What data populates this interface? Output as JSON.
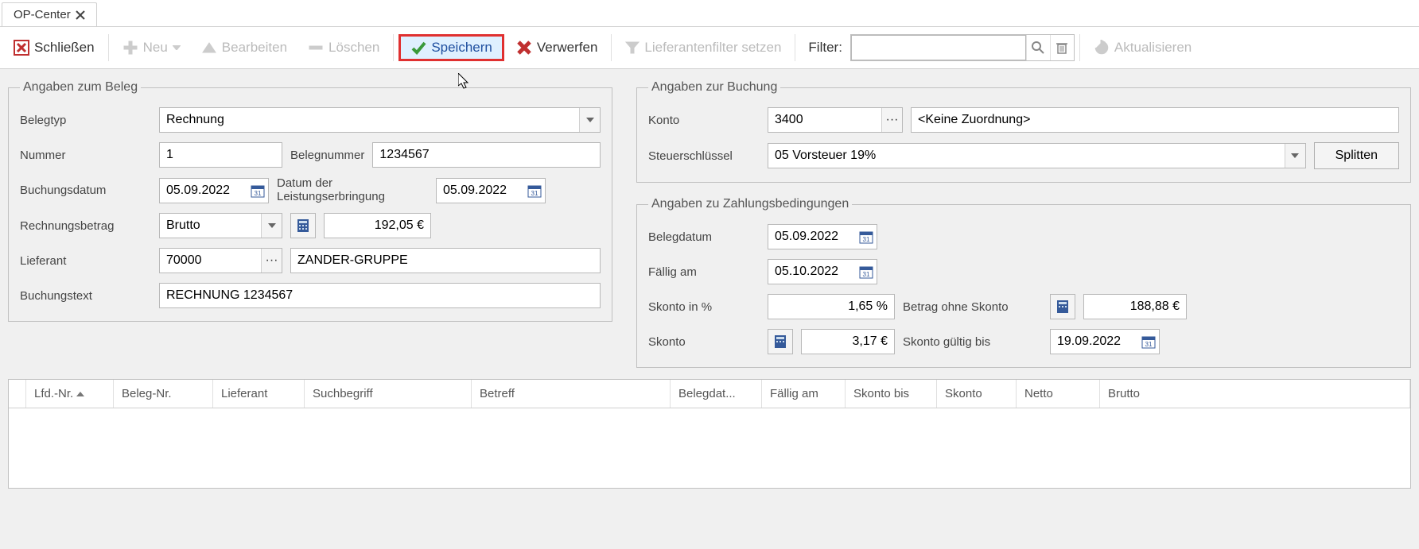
{
  "tab": {
    "title": "OP-Center"
  },
  "toolbar": {
    "close": "Schließen",
    "new": "Neu",
    "edit": "Bearbeiten",
    "delete": "Löschen",
    "save": "Speichern",
    "discard": "Verwerfen",
    "supplier_filter": "Lieferantenfilter setzen",
    "filter_label": "Filter:",
    "refresh": "Aktualisieren"
  },
  "beleg": {
    "legend": "Angaben zum Beleg",
    "belegtyp_label": "Belegtyp",
    "belegtyp_value": "Rechnung",
    "nummer_label": "Nummer",
    "nummer_value": "1",
    "belegnummer_label": "Belegnummer",
    "belegnummer_value": "1234567",
    "buchungsdatum_label": "Buchungsdatum",
    "buchungsdatum_value": "05.09.2022",
    "leistung_label": "Datum der Leistungserbringung",
    "leistung_value": "05.09.2022",
    "rbetrag_label": "Rechnungsbetrag",
    "rbetrag_mode": "Brutto",
    "rbetrag_value": "192,05 €",
    "lieferant_label": "Lieferant",
    "lieferant_code": "70000",
    "lieferant_name": "ZANDER-GRUPPE",
    "buchungstext_label": "Buchungstext",
    "buchungstext_value": "RECHNUNG 1234567"
  },
  "buchung": {
    "legend": "Angaben zur Buchung",
    "konto_label": "Konto",
    "konto_value": "3400",
    "konto_assign": "<Keine Zuordnung>",
    "steuer_label": "Steuerschlüssel",
    "steuer_value": "05 Vorsteuer 19%",
    "splitten": "Splitten"
  },
  "zahlung": {
    "legend": "Angaben zu Zahlungsbedingungen",
    "belegdatum_label": "Belegdatum",
    "belegdatum_value": "05.09.2022",
    "faellig_label": "Fällig am",
    "faellig_value": "05.10.2022",
    "skonto_pct_label": "Skonto in %",
    "skonto_pct_value": "1,65 %",
    "betrag_ohne_label": "Betrag ohne Skonto",
    "betrag_ohne_value": "188,88 €",
    "skonto_label": "Skonto",
    "skonto_value": "3,17 €",
    "skonto_bis_label": "Skonto gültig bis",
    "skonto_bis_value": "19.09.2022"
  },
  "table": {
    "cols": {
      "c0": "Lfd.-Nr.",
      "c1": "Beleg-Nr.",
      "c2": "Lieferant",
      "c3": "Suchbegriff",
      "c4": "Betreff",
      "c5": "Belegdat...",
      "c6": "Fällig am",
      "c7": "Skonto bis",
      "c8": "Skonto",
      "c9": "Netto",
      "c10": "Brutto"
    }
  }
}
